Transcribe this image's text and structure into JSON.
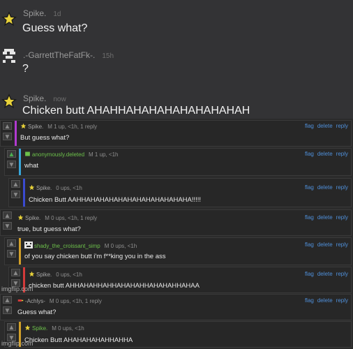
{
  "chat": [
    {
      "name": "Spike.",
      "time": "1d",
      "text": "Guess what?",
      "icon": "star-icon"
    },
    {
      "name": ".-GarrettTheFatFk-.",
      "time": "15h",
      "text": "?",
      "icon": "pixel-avatar-icon"
    },
    {
      "name": "Spike.",
      "time": "now",
      "text": "Chicken butt AHAHHAHAHAHAHAHAHAHAH",
      "icon": "star-icon"
    }
  ],
  "actions": {
    "flag": "flag",
    "delete": "delete",
    "reply": "reply"
  },
  "comments": [
    {
      "user": "Spike.",
      "meta": "M   1 up, <1h, 1 reply",
      "text": "But guess what?",
      "bar": "#b13ad0",
      "user_color": "#a8a8a8",
      "upvoted": false,
      "icon": "star-icon"
    },
    {
      "user": "anonymously.deleted",
      "meta": "M   1 up, <1h",
      "text": "what",
      "bar": "#39a6d9",
      "user_color": "#6cc04a",
      "upvoted": true,
      "icon": "green-shield-icon"
    },
    {
      "user": "Spike.",
      "meta": "0 ups, <1h",
      "text": "Chicken Butt AAHHAHAHAHAHAHAHAHAHAHAHAHA!!!!!",
      "bar": "#3a4ad0",
      "user_color": "#a8a8a8",
      "upvoted": false,
      "icon": "star-icon"
    },
    {
      "user": "Spike.",
      "meta": "M   0 ups, <1h, 1 reply",
      "text": "true, but guess what?",
      "bar": "#2b2b2b",
      "user_color": "#a8a8a8",
      "upvoted": false,
      "icon": "star-icon"
    },
    {
      "user": "shady_the_croissant_simp",
      "meta": "M   0 ups, <1h",
      "text": "of you say chicken butt i'm f**king you in the ass",
      "bar": "#d2a02a",
      "user_color": "#6cc04a",
      "upvoted": false,
      "icon": "pixel-face-icon"
    },
    {
      "user": "Spike.",
      "meta": "0 ups, <1h",
      "text": "chicken butt AHHAHAHHAHHAHAHAHHAHAHAHHAHAA",
      "bar": "#d23a3a",
      "user_color": "#a8a8a8",
      "upvoted": false,
      "icon": "star-icon"
    },
    {
      "user": "-Achlys-",
      "meta": "M   0 ups, <1h, 1 reply",
      "text": "Guess what?",
      "bar": "#2b2b2b",
      "user_color": "#a8a8a8",
      "upvoted": false,
      "icon": "red-flag-icon"
    },
    {
      "user": "Spike.",
      "meta": "M   0 ups, <1h",
      "text": "Chicken Butt AHAHAHAHAHHAHHA",
      "bar": "#d2a02a",
      "user_color": "#6cc04a",
      "upvoted": false,
      "icon": "star-icon"
    }
  ],
  "watermarks": [
    "imgflip.com",
    "imgflip.com"
  ]
}
